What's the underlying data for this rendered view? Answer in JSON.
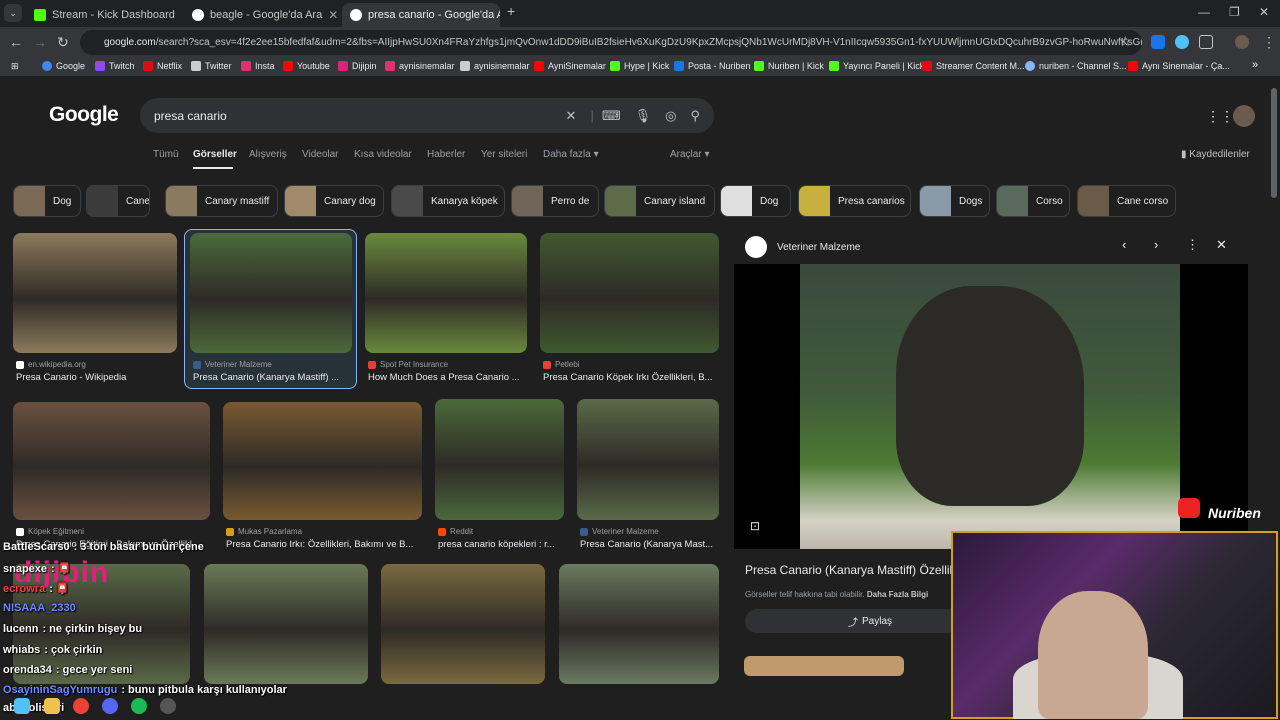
{
  "browser": {
    "tabs": [
      {
        "title": "Stream - Kick Dashboard",
        "color": "#53fc18",
        "active": false
      },
      {
        "title": "beagle - Google'da Ara",
        "color": "#ffffff",
        "active": false
      },
      {
        "title": "presa canario - Google'da Ara",
        "color": "#ffffff",
        "active": true
      }
    ],
    "new_tab": "+",
    "url_host": "google.com",
    "url_rest": "/search?sca_esv=4f2e2ee15bfedfaf&udm=2&fbs=AIIjpHwSU0Xn4FRaYzhfgs1jmQvOnw1dDD9iBuIB2fsieHv6XuKgDzU9KpxZMcpsjQNb1WcUrMDj8VH-V1nIIcqw5935Gn1-fxYUUWljmnUGtxDQcuhrB9zvGP-hoRwuNwfKsGmRGfYH61H...",
    "bookmarks": [
      {
        "label": "Google",
        "color": "#4285f4"
      },
      {
        "label": "Twitch",
        "color": "#9146ff"
      },
      {
        "label": "Netflix",
        "color": "#e50914"
      },
      {
        "label": "Twitter",
        "color": "#cccccc"
      },
      {
        "label": "Insta",
        "color": "#e1306c"
      },
      {
        "label": "Youtube",
        "color": "#ff0000"
      },
      {
        "label": "Dijipin",
        "color": "#e0207a"
      },
      {
        "label": "aynisinemalar",
        "color": "#e1306c"
      },
      {
        "label": "aynisinemalar",
        "color": "#cccccc"
      },
      {
        "label": "AyniSinemalar",
        "color": "#ff0000"
      },
      {
        "label": "Hype | Kick",
        "color": "#53fc18"
      },
      {
        "label": "Posta - Nuriben",
        "color": "#1a73e8"
      },
      {
        "label": "Nuriben | Kick",
        "color": "#53fc18"
      },
      {
        "label": "Yayıncı Paneli | Kick",
        "color": "#53fc18"
      },
      {
        "label": "Streamer Content M...",
        "color": "#e50914"
      },
      {
        "label": "nuriben - Channel S...",
        "color": "#8ab4f8"
      },
      {
        "label": "Aynı Sinemalar - Ça...",
        "color": "#ff0000"
      }
    ],
    "more_bookmarks": "»"
  },
  "google": {
    "logo": "Google",
    "query": "presa canario",
    "tabs": [
      {
        "label": "Tümü",
        "active": false
      },
      {
        "label": "Görseller",
        "active": true
      },
      {
        "label": "Alışveriş",
        "active": false
      },
      {
        "label": "Videolar",
        "active": false
      },
      {
        "label": "Kısa videolar",
        "active": false
      },
      {
        "label": "Haberler",
        "active": false
      },
      {
        "label": "Yer siteleri",
        "active": false
      },
      {
        "label": "Daha fazla ▾",
        "active": false
      }
    ],
    "tools": "Araçlar ▾",
    "saved": "Kaydedilenler",
    "chips": [
      {
        "label": "Dog",
        "color": "#7a6a55"
      },
      {
        "label": "Cane",
        "color": "#3b3b3b"
      },
      {
        "label": "Canary mastiff",
        "color": "#8a7a60"
      },
      {
        "label": "Canary dog",
        "color": "#a08a6a"
      },
      {
        "label": "Kanarya köpek",
        "color": "#4a4a4a"
      },
      {
        "label": "Perro de",
        "color": "#6e6458"
      },
      {
        "label": "Canary island",
        "color": "#5e6b48"
      },
      {
        "label": "Dog",
        "color": "#e0e0e0"
      },
      {
        "label": "Presa canarios",
        "color": "#c8b040"
      },
      {
        "label": "Dogs",
        "color": "#8a9aa8"
      },
      {
        "label": "Corso",
        "color": "#5a6a5a"
      },
      {
        "label": "Cane corso",
        "color": "#6a5a48"
      }
    ],
    "results": [
      {
        "source": "en.wikipedia.org",
        "title": "Presa Canario - Wikipedia",
        "color": "#8c7a5c",
        "fav": "#ffffff"
      },
      {
        "source": "Veteriner Malzeme",
        "title": "Presa Canario (Kanarya Mastiff) ...",
        "color": "#4b6a3c",
        "fav": "#3a5a8a"
      },
      {
        "source": "Spot Pet Insurance",
        "title": "How Much Does a Presa Canario ...",
        "color": "#6a8a3e",
        "fav": "#e34234"
      },
      {
        "source": "Petlebi",
        "title": "Presa Canario Köpek Irkı Özellikleri, B...",
        "color": "#3f5a30",
        "fav": "#e34234"
      },
      {
        "source": "Köpek Eğitmeni",
        "title": "Presa Canario Eğitimi - Bakımı ve Özellikl...",
        "color": "#6a5040",
        "fav": "#ffffff"
      },
      {
        "source": "Mukas Pazarlama",
        "title": "Presa Canario Irkı: Özellikleri, Bakımı ve B...",
        "color": "#7a5a30",
        "fav": "#d4a017"
      },
      {
        "source": "Reddit",
        "title": "presa canario köpekleri : r...",
        "color": "#4a6a3a",
        "fav": "#ff4500"
      },
      {
        "source": "Veteriner Malzeme",
        "title": "Presa Canario (Kanarya Mast...",
        "color": "#5a6a48",
        "fav": "#3a5a8a"
      },
      {
        "source": "",
        "title": "",
        "color": "#5a6a48",
        "fav": "#000000"
      },
      {
        "source": "",
        "title": "",
        "color": "#6a7a58",
        "fav": "#000000"
      },
      {
        "source": "",
        "title": "",
        "color": "#7a6a40",
        "fav": "#000000"
      },
      {
        "source": "",
        "title": "",
        "color": "#6a7a60",
        "fav": "#000000"
      }
    ],
    "watermark": "dijipin",
    "panel": {
      "source": "Veteriner Malzeme",
      "title": "Presa Canario (Kanarya Mastiff) Özellik",
      "note": "Görseller telif hakkına tabi olabilir.",
      "note_link": "Daha Fazla Bilgi",
      "share": "Paylaş"
    }
  },
  "stream": {
    "chat": [
      {
        "user": "BattleScars0",
        "color": "#ffffff",
        "msg": ": 3 ton basar bunun çene"
      },
      {
        "user": "snapexe",
        "color": "#ffffff",
        "msg": ": 📮"
      },
      {
        "user": "ecrowra",
        "color": "#ff3b3b",
        "msg": ": 📮"
      },
      {
        "user": "NISAAA_2330",
        "color": "#6b8cff",
        "msg": ""
      },
      {
        "user": "lucenn",
        "color": "#ffffff",
        "msg": ": ne çirkin bişey bu"
      },
      {
        "user": "whiabs",
        "color": "#ffffff",
        "msg": ": çok çirkin"
      },
      {
        "user": "orenda34",
        "color": "#ffffff",
        "msg": ": gece yer seni"
      },
      {
        "user": "OsayininSagYumrugu",
        "color": "#6b8cff",
        "msg": ": bunu pitbula karşı kullanıyolar"
      },
      {
        "user": "abi polisleri",
        "color": "#ffffff",
        "msg": ""
      }
    ],
    "brand": "Nuriben"
  }
}
